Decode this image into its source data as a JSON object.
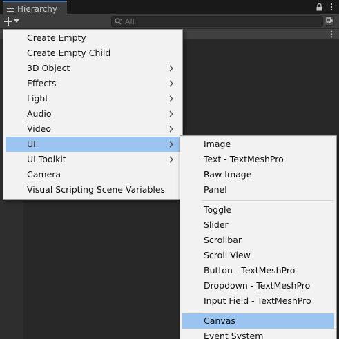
{
  "window": {
    "tab_title": "Hierarchy",
    "search_placeholder": "All"
  },
  "context_menu": {
    "items": [
      {
        "label": "Create Empty",
        "submenu": false
      },
      {
        "label": "Create Empty Child",
        "submenu": false
      },
      {
        "label": "3D Object",
        "submenu": true
      },
      {
        "label": "Effects",
        "submenu": true
      },
      {
        "label": "Light",
        "submenu": true
      },
      {
        "label": "Audio",
        "submenu": true
      },
      {
        "label": "Video",
        "submenu": true
      },
      {
        "label": "UI",
        "submenu": true,
        "selected": true
      },
      {
        "label": "UI Toolkit",
        "submenu": true
      },
      {
        "label": "Camera",
        "submenu": false
      },
      {
        "label": "Visual Scripting Scene Variables",
        "submenu": false
      }
    ]
  },
  "ui_submenu": {
    "items": [
      "Image",
      "Text - TextMeshPro",
      "Raw Image",
      "Panel",
      "Toggle",
      "Slider",
      "Scrollbar",
      "Scroll View",
      "Button - TextMeshPro",
      "Dropdown - TextMeshPro",
      "Input Field - TextMeshPro",
      "Canvas",
      "Event System"
    ],
    "selected": "Canvas"
  },
  "colors": {
    "highlight": "#9bc5f0",
    "menu_bg": "#f2f2f2",
    "tab_accent": "#3a79bb",
    "panel_bg": "#282828"
  }
}
